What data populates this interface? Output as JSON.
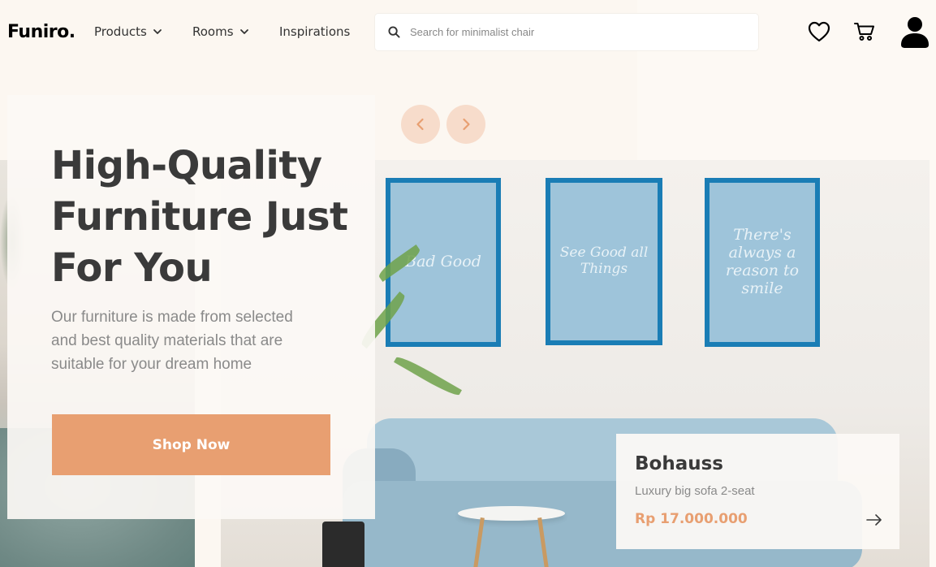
{
  "brand": {
    "logo_text": "Funiro."
  },
  "nav": {
    "items": [
      {
        "label": "Products",
        "has_dropdown": true
      },
      {
        "label": "Rooms",
        "has_dropdown": true
      },
      {
        "label": "Inspirations",
        "has_dropdown": false
      }
    ],
    "search": {
      "placeholder": "Search for minimalist chair",
      "value": ""
    },
    "icons": [
      "heart-icon",
      "cart-icon",
      "user-icon"
    ]
  },
  "hero": {
    "title": "High-Quality Furniture Just For You",
    "description": "Our furniture is made from selected and best quality materials that are suitable for your dream home",
    "cta_label": "Shop Now"
  },
  "slider": {
    "prev_icon": "chevron-left-icon",
    "next_icon": "chevron-right-icon"
  },
  "room_posters": [
    "Bad Good",
    "See Good all Things",
    "There's always a reason to smile"
  ],
  "featured_product": {
    "name": "Bohauss",
    "description": "Luxury big sofa 2-seat",
    "price": "Rp 17.000.000",
    "action_icon": "arrow-right-icon"
  },
  "colors": {
    "accent": "#e89f71",
    "arrow_bg": "#f7dccb",
    "bg_beige": "#fcf7f1",
    "text_dark": "#3a3a3a",
    "text_muted": "#8a8a8a"
  }
}
